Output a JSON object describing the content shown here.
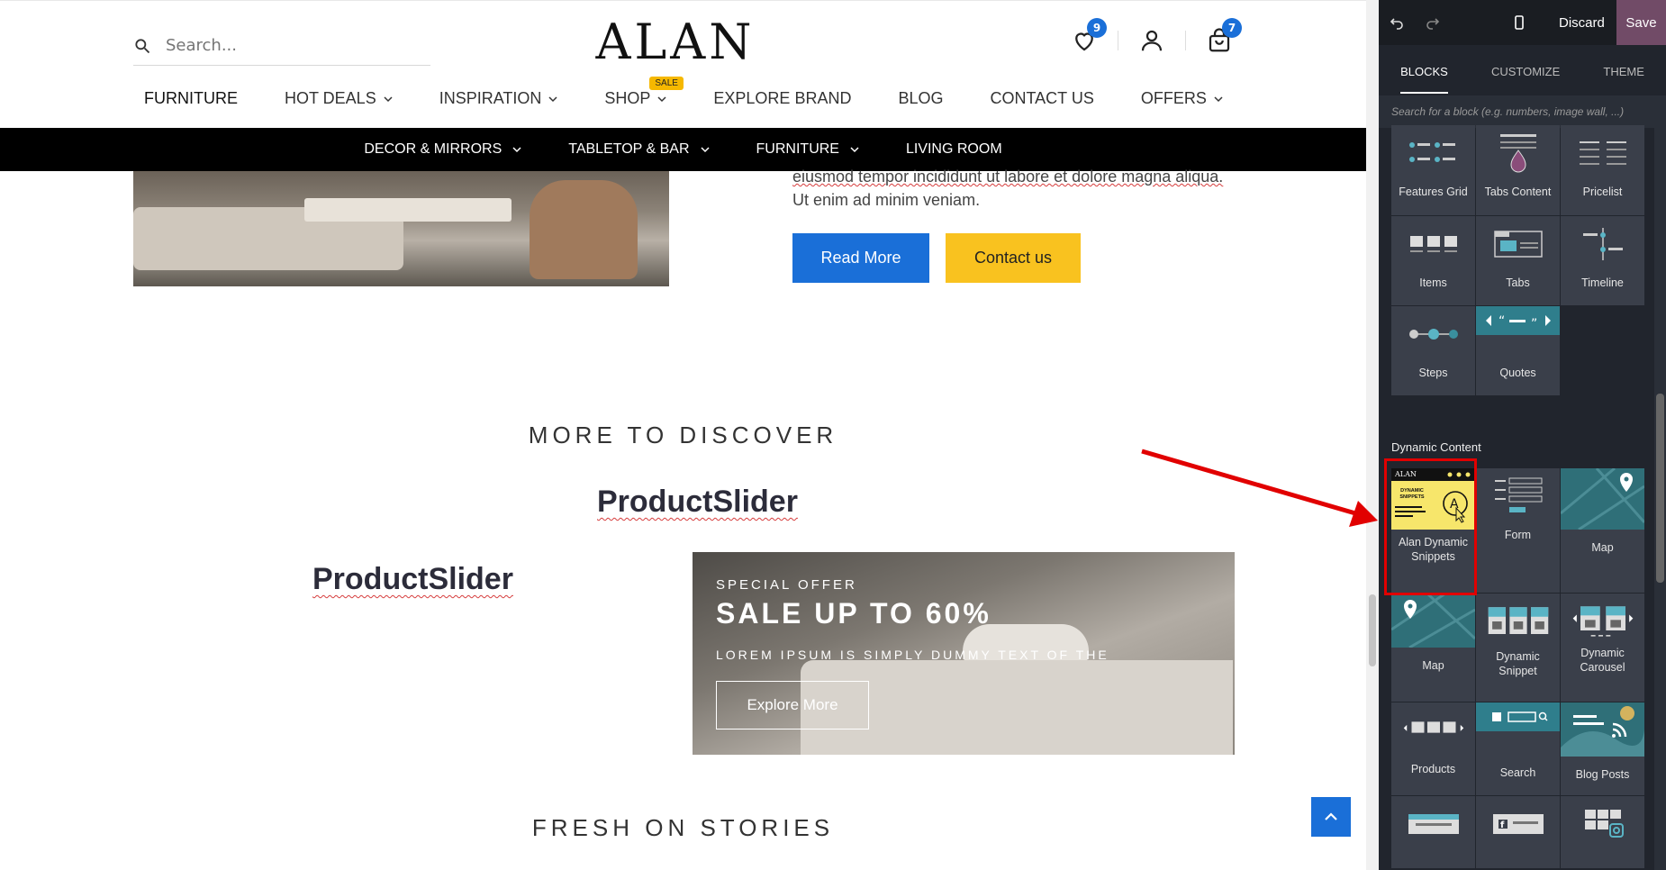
{
  "site": {
    "search_placeholder": "Search...",
    "logo": "ALAN",
    "wishlist_count": "9",
    "cart_count": "7",
    "main_nav": [
      {
        "label": "FURNITURE"
      },
      {
        "label": "HOT DEALS"
      },
      {
        "label": "INSPIRATION"
      },
      {
        "label": "SHOP",
        "badge": "SALE"
      },
      {
        "label": "EXPLORE BRAND"
      },
      {
        "label": "BLOG"
      },
      {
        "label": "CONTACT US"
      },
      {
        "label": "OFFERS"
      }
    ],
    "sub_nav": [
      "DECOR & MIRRORS",
      "TABLETOP & BAR",
      "FURNITURE",
      "LIVING ROOM"
    ],
    "hero_text_line1": "eiusmod tempor incididunt ut labore et dolore magna aliqua.",
    "hero_text_line2": "Ut enim ad minim veniam.",
    "read_more": "Read More",
    "contact_us": "Contact us",
    "more_to_discover": "MORE TO DISCOVER",
    "product_slider_1": "ProductSlider",
    "product_slider_2": "ProductSlider",
    "offer": {
      "kicker": "SPECIAL OFFER",
      "title": "SALE UP TO 60%",
      "text": "LOREM IPSUM IS SIMPLY DUMMY TEXT OF THE",
      "button": "Explore More"
    },
    "fresh_on_stories": "FRESH ON STORIES"
  },
  "panel": {
    "discard": "Discard",
    "save": "Save",
    "tabs": [
      "BLOCKS",
      "CUSTOMIZE",
      "THEME"
    ],
    "search_placeholder": "Search for a block (e.g. numbers, image wall, ...)",
    "blocks_top": [
      "Features Grid",
      "Tabs Content",
      "Pricelist",
      "Items",
      "Tabs",
      "Timeline",
      "Steps",
      "Quotes"
    ],
    "dynamic_section": "Dynamic Content",
    "dynamic_blocks": [
      "Alan Dynamic Snippets",
      "Form",
      "Map",
      "Map",
      "Dynamic Snippet",
      "Dynamic Carousel",
      "Products",
      "Search",
      "Blog Posts"
    ],
    "alan_card_logo": "ALAN",
    "alan_card_text": "DYNAMIC SNIPPETS"
  },
  "colors": {
    "accent_blue": "#1a6fd8",
    "accent_yellow": "#f9c21f",
    "odoo_purple": "#714b67",
    "highlight_red": "#e10000"
  }
}
